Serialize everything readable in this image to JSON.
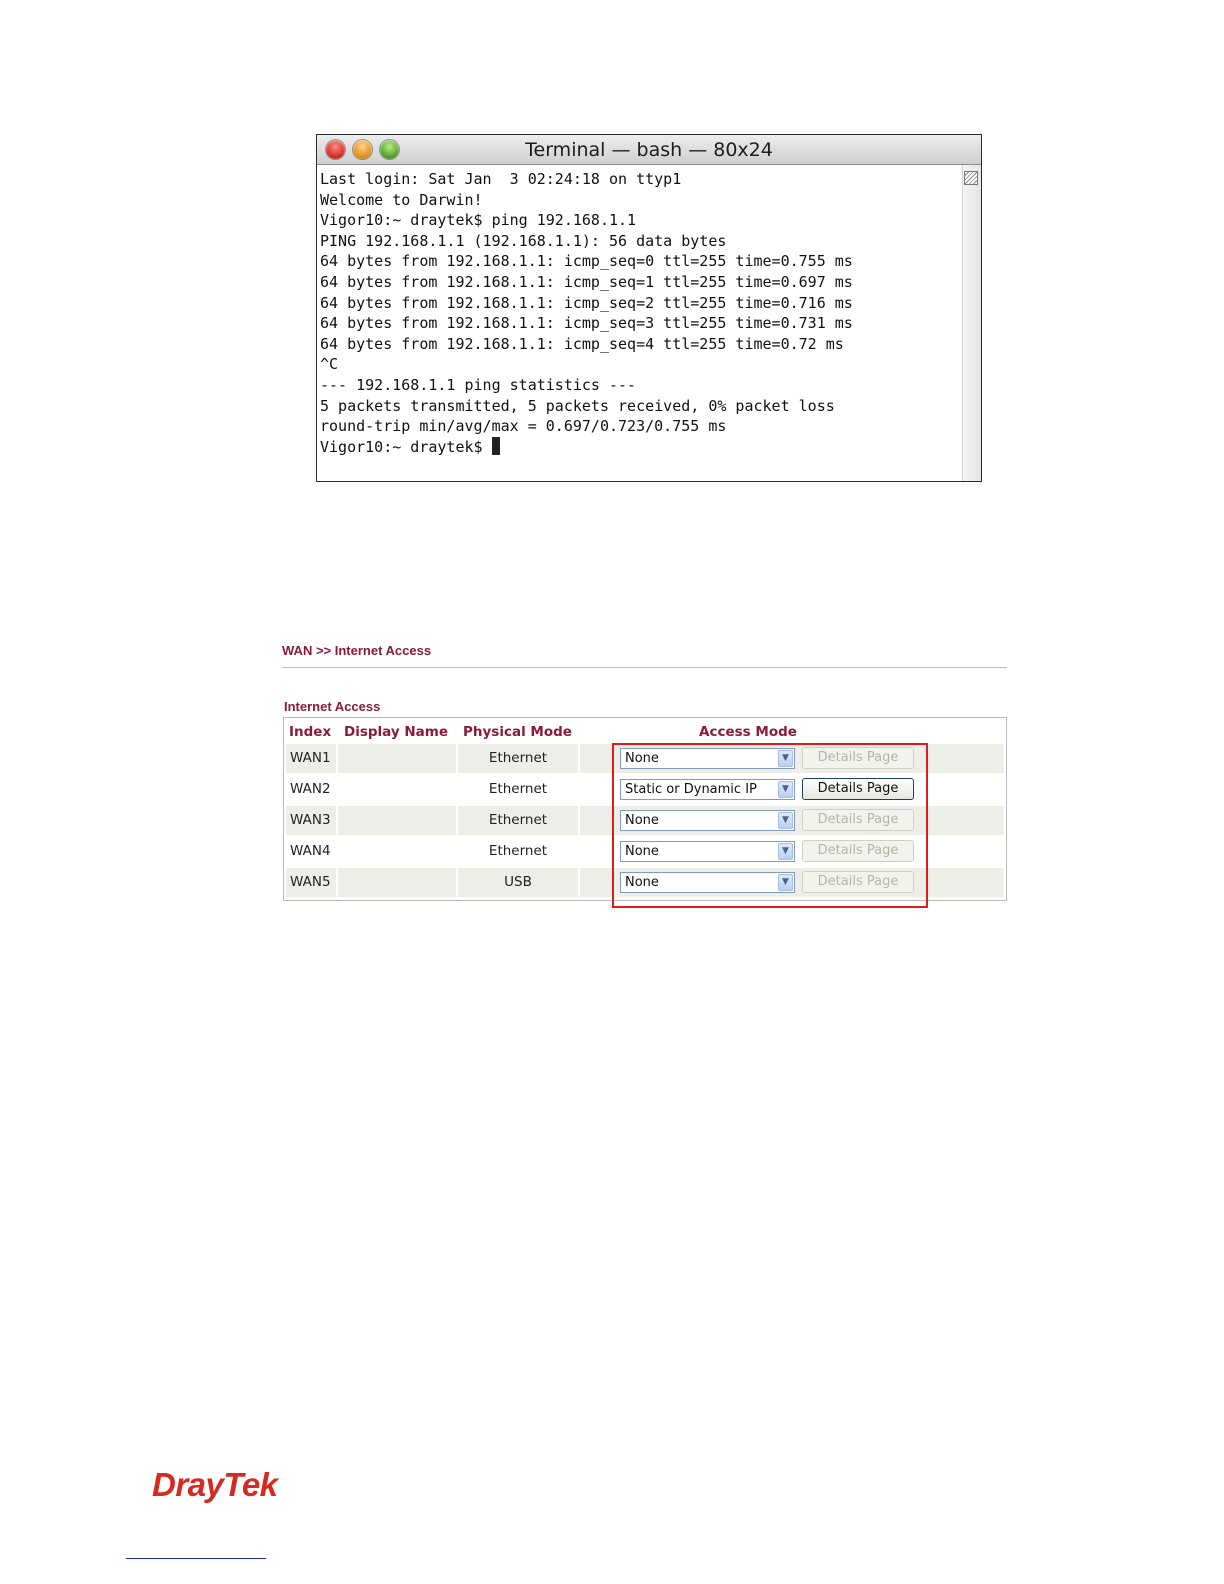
{
  "terminal": {
    "title": "Terminal — bash — 80x24",
    "lines": [
      "Last login: Sat Jan  3 02:24:18 on ttyp1",
      "Welcome to Darwin!",
      "Vigor10:~ draytek$ ping 192.168.1.1",
      "PING 192.168.1.1 (192.168.1.1): 56 data bytes",
      "64 bytes from 192.168.1.1: icmp_seq=0 ttl=255 time=0.755 ms",
      "64 bytes from 192.168.1.1: icmp_seq=1 ttl=255 time=0.697 ms",
      "64 bytes from 192.168.1.1: icmp_seq=2 ttl=255 time=0.716 ms",
      "64 bytes from 192.168.1.1: icmp_seq=3 ttl=255 time=0.731 ms",
      "64 bytes from 192.168.1.1: icmp_seq=4 ttl=255 time=0.72 ms",
      "^C",
      "--- 192.168.1.1 ping statistics ---",
      "5 packets transmitted, 5 packets received, 0% packet loss",
      "round-trip min/avg/max = 0.697/0.723/0.755 ms",
      "Vigor10:~ draytek$ "
    ]
  },
  "router": {
    "breadcrumb": "WAN >> Internet Access",
    "section_title": "Internet Access",
    "columns": {
      "index": "Index",
      "display_name": "Display Name",
      "physical_mode": "Physical Mode",
      "access_mode": "Access Mode"
    },
    "rows": [
      {
        "index": "WAN1",
        "display_name": "",
        "physical_mode": "Ethernet",
        "access_mode": "None",
        "details_label": "Details Page"
      },
      {
        "index": "WAN2",
        "display_name": "",
        "physical_mode": "Ethernet",
        "access_mode": "Static or Dynamic IP",
        "details_label": "Details Page"
      },
      {
        "index": "WAN3",
        "display_name": "",
        "physical_mode": "Ethernet",
        "access_mode": "None",
        "details_label": "Details Page"
      },
      {
        "index": "WAN4",
        "display_name": "",
        "physical_mode": "Ethernet",
        "access_mode": "None",
        "details_label": "Details Page"
      },
      {
        "index": "WAN5",
        "display_name": "",
        "physical_mode": "USB",
        "access_mode": "None",
        "details_label": "Details Page"
      }
    ]
  },
  "footer": {
    "logo_text": "DrayTek"
  },
  "colors": {
    "accent": "#8a1a3c",
    "highlight": "#e01b1b",
    "logo": "#d42a1f"
  }
}
